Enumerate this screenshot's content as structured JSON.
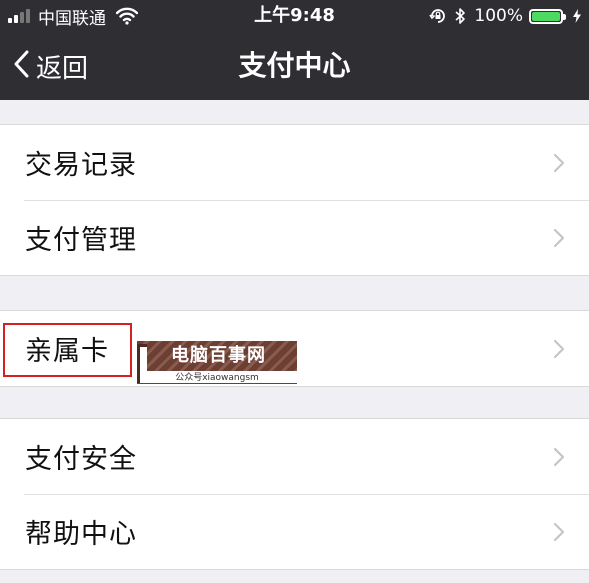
{
  "status_bar": {
    "carrier": "中国联通",
    "time": "上午9:48",
    "battery_percent": "100%",
    "battery_level": 1.0,
    "icons": [
      "signal-icon",
      "wifi-icon",
      "rotation-lock-icon",
      "bluetooth-icon",
      "battery-icon",
      "charging-icon"
    ]
  },
  "nav": {
    "back_label": "返回",
    "title": "支付中心"
  },
  "groups": [
    {
      "items": [
        {
          "label": "交易记录"
        },
        {
          "label": "支付管理"
        }
      ]
    },
    {
      "items": [
        {
          "label": "亲属卡",
          "highlighted": true
        }
      ]
    },
    {
      "items": [
        {
          "label": "支付安全"
        },
        {
          "label": "帮助中心"
        }
      ]
    }
  ],
  "watermark": {
    "title": "电脑百事网",
    "subtitle": "公众号xiaowangsm"
  },
  "colors": {
    "nav_background": "#2e2e33",
    "page_background": "#efeff4",
    "highlight_border": "#d42020",
    "battery_green": "#4cd964"
  }
}
